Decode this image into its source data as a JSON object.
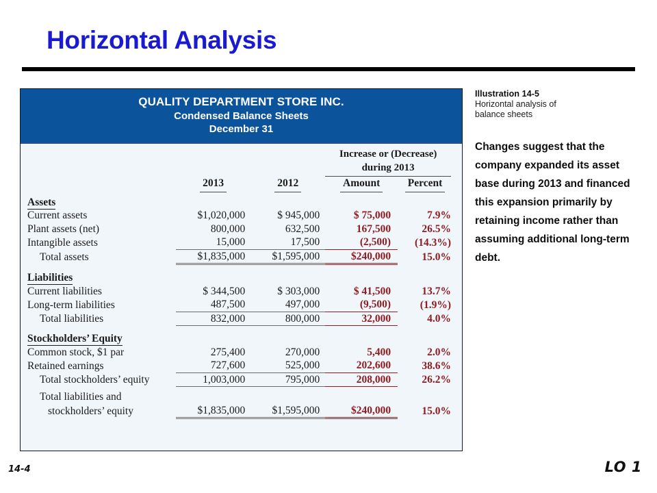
{
  "slide": {
    "title": "Horizontal Analysis",
    "page_number": "14-4",
    "lo_tag": "LO 1"
  },
  "exhibit": {
    "company": "QUALITY DEPARTMENT STORE INC.",
    "statement": "Condensed Balance Sheets",
    "date": "December 31",
    "group_header": {
      "line1": "Increase or (Decrease)",
      "line2": "during 2013"
    },
    "columns": {
      "label": "",
      "year_current": "2013",
      "year_prior": "2012",
      "amount": "Amount",
      "percent": "Percent"
    },
    "sections": [
      {
        "heading": "Assets",
        "rows": [
          {
            "label": "Current assets",
            "y2013": "$1,020,000",
            "y2012": "$  945,000",
            "amount": "$  75,000",
            "percent": "7.9%"
          },
          {
            "label": "Plant assets (net)",
            "y2013": "800,000",
            "y2012": "632,500",
            "amount": "167,500",
            "percent": "26.5%"
          },
          {
            "label": "Intangible assets",
            "y2013": "15,000",
            "y2012": "17,500",
            "amount": "(2,500)",
            "percent": "(14.3%)"
          }
        ],
        "total": {
          "label": "Total assets",
          "y2013": "$1,835,000",
          "y2012": "$1,595,000",
          "amount": "$240,000",
          "percent": "15.0%"
        }
      },
      {
        "heading": "Liabilities",
        "rows": [
          {
            "label": "Current liabilities",
            "y2013": "$  344,500",
            "y2012": "$  303,000",
            "amount": "$  41,500",
            "percent": "13.7%"
          },
          {
            "label": "Long-term liabilities",
            "y2013": "487,500",
            "y2012": "497,000",
            "amount": "(9,500)",
            "percent": "(1.9%)"
          }
        ],
        "total": {
          "label": "Total liabilities",
          "y2013": "832,000",
          "y2012": "800,000",
          "amount": "32,000",
          "percent": "4.0%"
        }
      },
      {
        "heading": "Stockholders’ Equity",
        "rows": [
          {
            "label": "Common stock, $1 par",
            "y2013": "275,400",
            "y2012": "270,000",
            "amount": "5,400",
            "percent": "2.0%"
          },
          {
            "label": "Retained earnings",
            "y2013": "727,600",
            "y2012": "525,000",
            "amount": "202,600",
            "percent": "38.6%"
          }
        ],
        "total": {
          "label": "Total stockholders’ equity",
          "y2013": "1,003,000",
          "y2012": "795,000",
          "amount": "208,000",
          "percent": "26.2%"
        }
      }
    ],
    "grand_total": {
      "label_line1": "Total liabilities and",
      "label_line2": "stockholders’ equity",
      "y2013": "$1,835,000",
      "y2012": "$1,595,000",
      "amount": "$240,000",
      "percent": "15.0%"
    }
  },
  "side": {
    "illustration_label": "Illustration 14-5",
    "illustration_caption": "Horizontal analysis of balance sheets",
    "commentary": "Changes suggest that the company expanded its asset base during 2013 and financed this expansion primarily by retaining income rather than assuming additional long-term debt."
  },
  "colors": {
    "title_blue": "#1a1ad0",
    "header_blue": "#0b549c",
    "accent_red": "#8e1c21",
    "sheet_background": "#f1f6fa"
  }
}
